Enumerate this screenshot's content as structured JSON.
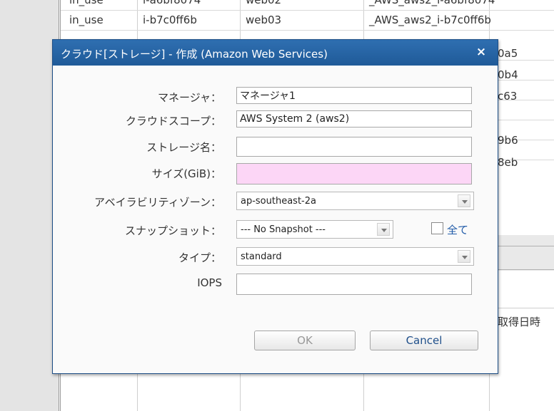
{
  "background": {
    "top_row_fragment": [
      "in_use",
      "i-a6bf8074",
      "web02",
      "_AWS_aws2_i-a6bf8074"
    ],
    "row2": [
      "in_use",
      "i-b7c0ff6b",
      "web03",
      "_AWS_aws2_i-b7c0ff6b"
    ],
    "right_fragments": [
      "0a5",
      "0b4",
      "c63",
      "9b6",
      "8eb"
    ],
    "col_header_fragment": "取得日時"
  },
  "dialog": {
    "title": "クラウド[ストレージ] - 作成 (Amazon Web Services)",
    "close": "×",
    "fields": {
      "manager_label": "マネージャ：",
      "manager_value": "マネージャ1",
      "scope_label": "クラウドスコープ：",
      "scope_value": "AWS System 2 (aws2)",
      "storage_name_label": "ストレージ名：",
      "storage_name_value": "",
      "size_label": "サイズ(GiB)：",
      "size_value": "",
      "az_label": "アベイラビリティゾーン：",
      "az_value": "ap-southeast-2a",
      "snapshot_label": "スナップショット：",
      "snapshot_value": "--- No Snapshot ---",
      "all_label": "全て",
      "type_label": "タイプ：",
      "type_value": "standard",
      "iops_label": "IOPS",
      "iops_value": ""
    },
    "buttons": {
      "ok": "OK",
      "cancel": "Cancel"
    }
  }
}
